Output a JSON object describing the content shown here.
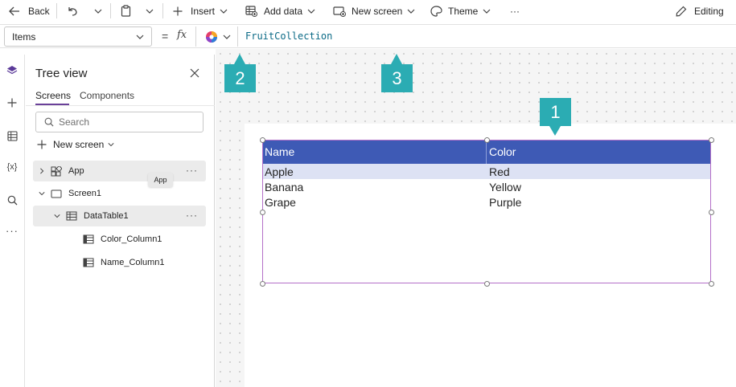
{
  "toolbar": {
    "back_label": "Back",
    "insert_label": "Insert",
    "add_data_label": "Add data",
    "new_screen_label": "New screen",
    "theme_label": "Theme",
    "more_label": "···",
    "editing_label": "Editing"
  },
  "formula_bar": {
    "property": "Items",
    "fx_label": "fx",
    "formula": "FruitCollection"
  },
  "tree_view": {
    "title": "Tree view",
    "tabs": [
      "Screens",
      "Components"
    ],
    "search_placeholder": "Search",
    "new_screen_label": "New screen",
    "nodes": [
      {
        "label": "App",
        "icon": "app-grid-icon"
      },
      {
        "label": "Screen1",
        "icon": "screen-icon"
      },
      {
        "label": "DataTable1",
        "icon": "table-icon"
      },
      {
        "label": "Color_Column1",
        "icon": "column-icon"
      },
      {
        "label": "Name_Column1",
        "icon": "column-icon"
      }
    ],
    "tooltip": "App"
  },
  "data_table": {
    "columns": [
      "Name",
      "Color"
    ],
    "rows": [
      [
        "Apple",
        "Red"
      ],
      [
        "Banana",
        "Yellow"
      ],
      [
        "Grape",
        "Purple"
      ]
    ]
  },
  "callouts": [
    "1",
    "2",
    "3"
  ],
  "colors": {
    "header_bg": "#3e5ab5",
    "callout_bg": "#2bacb3",
    "selection_border": "#b46fc8",
    "tab_underline": "#6a4199"
  }
}
